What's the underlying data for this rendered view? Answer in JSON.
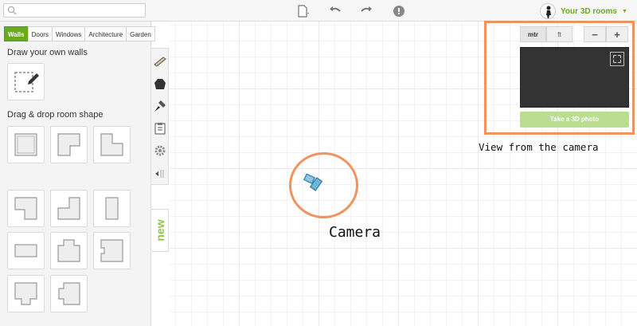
{
  "toolbar": {
    "search_placeholder": "",
    "icons": [
      "search-icon",
      "new-file-icon",
      "undo-icon",
      "redo-icon",
      "help-icon",
      "avatar-icon"
    ]
  },
  "user_menu": {
    "label": "Your 3D rooms",
    "caret": "▼"
  },
  "tabs": [
    {
      "label": "Walls",
      "active": true
    },
    {
      "label": "Doors"
    },
    {
      "label": "Windows"
    },
    {
      "label": "Architecture"
    },
    {
      "label": "Garden"
    }
  ],
  "panel": {
    "walls_heading": "Draw your own walls",
    "shapes_heading": "Drag & drop room shape"
  },
  "side_tools": [
    "walls-tool-icon",
    "shapes-tool-icon",
    "paint-tool-icon",
    "list-tool-icon",
    "settings-tool-icon",
    "collapse-icon"
  ],
  "new_tab": {
    "label": "new"
  },
  "preview": {
    "units": [
      "mtr",
      "ft"
    ],
    "selected_unit": "mtr",
    "zoom_out": "−",
    "zoom_in": "+",
    "photo_button": "Take a 3D photo"
  },
  "annotations": {
    "view_label": "View from the camera",
    "camera_label": "Camera"
  },
  "colors": {
    "accent": "#6aaa1f",
    "annotation": "#f0935f",
    "screen": "#333333"
  }
}
